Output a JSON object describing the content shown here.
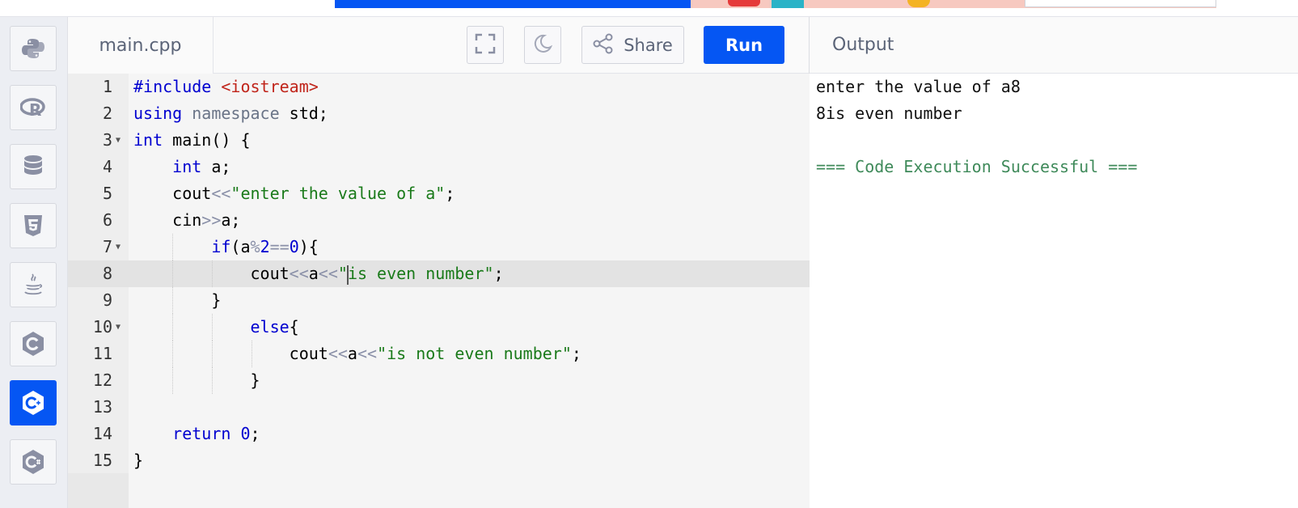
{
  "toolbar": {
    "file_name": "main.cpp",
    "share_label": "Share",
    "run_label": "Run"
  },
  "sidebar": {
    "languages": [
      {
        "name": "python-icon"
      },
      {
        "name": "r-icon"
      },
      {
        "name": "database-icon"
      },
      {
        "name": "html5-icon"
      },
      {
        "name": "java-icon"
      },
      {
        "name": "c-icon"
      },
      {
        "name": "cpp-icon",
        "active": true
      },
      {
        "name": "csharp-icon"
      }
    ]
  },
  "editor": {
    "line_numbers": [
      "1",
      "2",
      "3",
      "4",
      "5",
      "6",
      "7",
      "8",
      "9",
      "10",
      "11",
      "12",
      "13",
      "14",
      "15"
    ],
    "lines": [
      "#include <iostream>",
      "using namespace std;",
      "int main() {",
      "    int a;",
      "    cout<<\"enter the value of a\";",
      "    cin>>a;",
      "        if(a%2==0){",
      "            cout<<a<<\"is even number\";",
      "        }",
      "            else{",
      "                cout<<a<<\"is not even number\";",
      "            }",
      "",
      "    return 0;",
      "}"
    ],
    "active_line": 8
  },
  "output": {
    "header": "Output",
    "lines": [
      "enter the value of a8",
      "8is even number",
      "",
      "=== Code Execution Successful ==="
    ]
  },
  "colors": {
    "accent": "#0556f3",
    "keyword": "#0000d0",
    "string": "#1a7a1a",
    "include": "#c0241a",
    "success": "#3f8a5a"
  }
}
